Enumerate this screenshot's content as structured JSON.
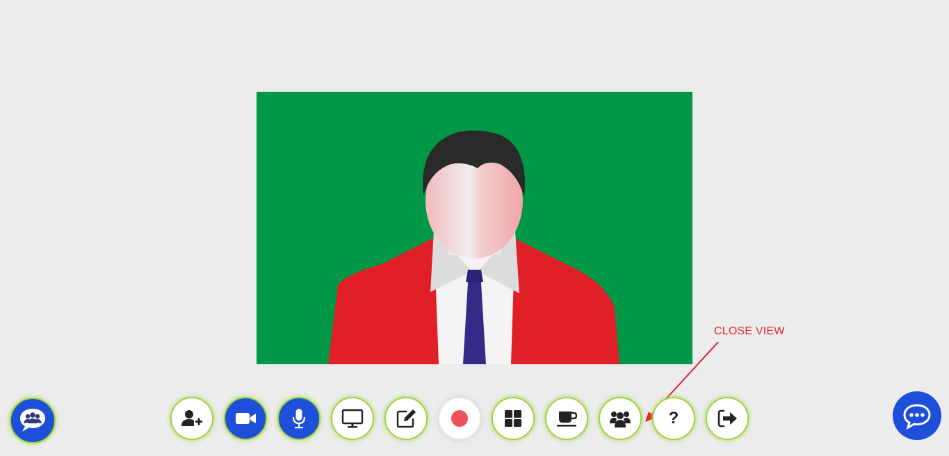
{
  "video": {
    "background_color": "#009846",
    "avatar": "placeholder-man-in-red-suit"
  },
  "toolbar": {
    "buttons": [
      {
        "name": "add-participant",
        "icon": "user-plus-icon",
        "active": false
      },
      {
        "name": "camera",
        "icon": "video-camera-icon",
        "active": true
      },
      {
        "name": "microphone",
        "icon": "microphone-icon",
        "active": true
      },
      {
        "name": "screen-share",
        "icon": "monitor-icon",
        "active": false
      },
      {
        "name": "whiteboard",
        "icon": "edit-icon",
        "active": false
      },
      {
        "name": "record",
        "icon": "record-icon",
        "active": false
      },
      {
        "name": "layout",
        "icon": "grid-icon",
        "active": false
      },
      {
        "name": "break",
        "icon": "coffee-icon",
        "active": false
      },
      {
        "name": "close-view",
        "icon": "users-icon",
        "active": false
      },
      {
        "name": "help",
        "icon": "question-icon",
        "label": "?",
        "active": false
      },
      {
        "name": "leave",
        "icon": "sign-out-icon",
        "active": false
      }
    ]
  },
  "annotation": {
    "label": "CLOSE VIEW",
    "color": "#e8262a"
  },
  "colors": {
    "accent_blue": "#1d4fd9",
    "ring_green": "#9fd24a",
    "record_red": "#f0505a",
    "page_bg": "#ececec"
  },
  "side_buttons": {
    "left": "participants-chat-icon",
    "right": "chat-icon"
  }
}
